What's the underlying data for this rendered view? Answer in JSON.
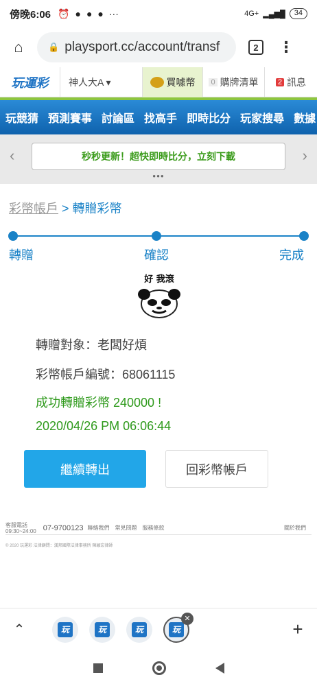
{
  "status_bar": {
    "time": "傍晚6:06",
    "icons": [
      "⏰",
      "●",
      "●",
      "●",
      "···"
    ],
    "network": "4G+",
    "battery": "34"
  },
  "browser": {
    "url": "playsport.cc/account/transf",
    "tab_count": "2"
  },
  "header": {
    "logo": "玩運彩",
    "user": "神人大A ▾",
    "buy_coin": "買噱幣",
    "cart_count": "0",
    "cart": "購牌清單",
    "msg_count": "2",
    "msg": "訊息"
  },
  "nav": {
    "items": [
      "玩競猜",
      "預測賽事",
      "討論區",
      "找高手",
      "即時比分",
      "玩家搜尋",
      "數據"
    ]
  },
  "banner": {
    "text": "秒秒更新！超快即時比分，立刻下載",
    "left_arrow": "‹",
    "right_arrow": "›"
  },
  "breadcrumb": {
    "parent": "彩幣帳戶",
    "separator": " > ",
    "current": "轉贈彩幣"
  },
  "steps": {
    "step1": "轉贈",
    "step2": "確認",
    "step3": "完成"
  },
  "meme": {
    "caption": "好 我滾"
  },
  "details": {
    "recipient": "轉贈對象：老闆好煩",
    "account": "彩幣帳戶編號：68061115",
    "success": "成功轉贈彩幣 240000 !",
    "timestamp": "2020/04/26 PM 06:06:44"
  },
  "buttons": {
    "continue": "繼續轉出",
    "back": "回彩幣帳戶"
  },
  "footer": {
    "service_label": "客服電話",
    "service_hours": "09:30~24:00",
    "phone": "07-9700123",
    "links": [
      "聯絡我們",
      "常見問題",
      "服務條款"
    ],
    "right_link": "關於我們",
    "copyright": "© 2020 玩運彩  法律顧問：漢邦國際法律事務所 陳穎宏律師"
  },
  "tabbar": {
    "tab_icon_text": "玩",
    "close": "✕",
    "up": "⌃",
    "add": "+"
  }
}
